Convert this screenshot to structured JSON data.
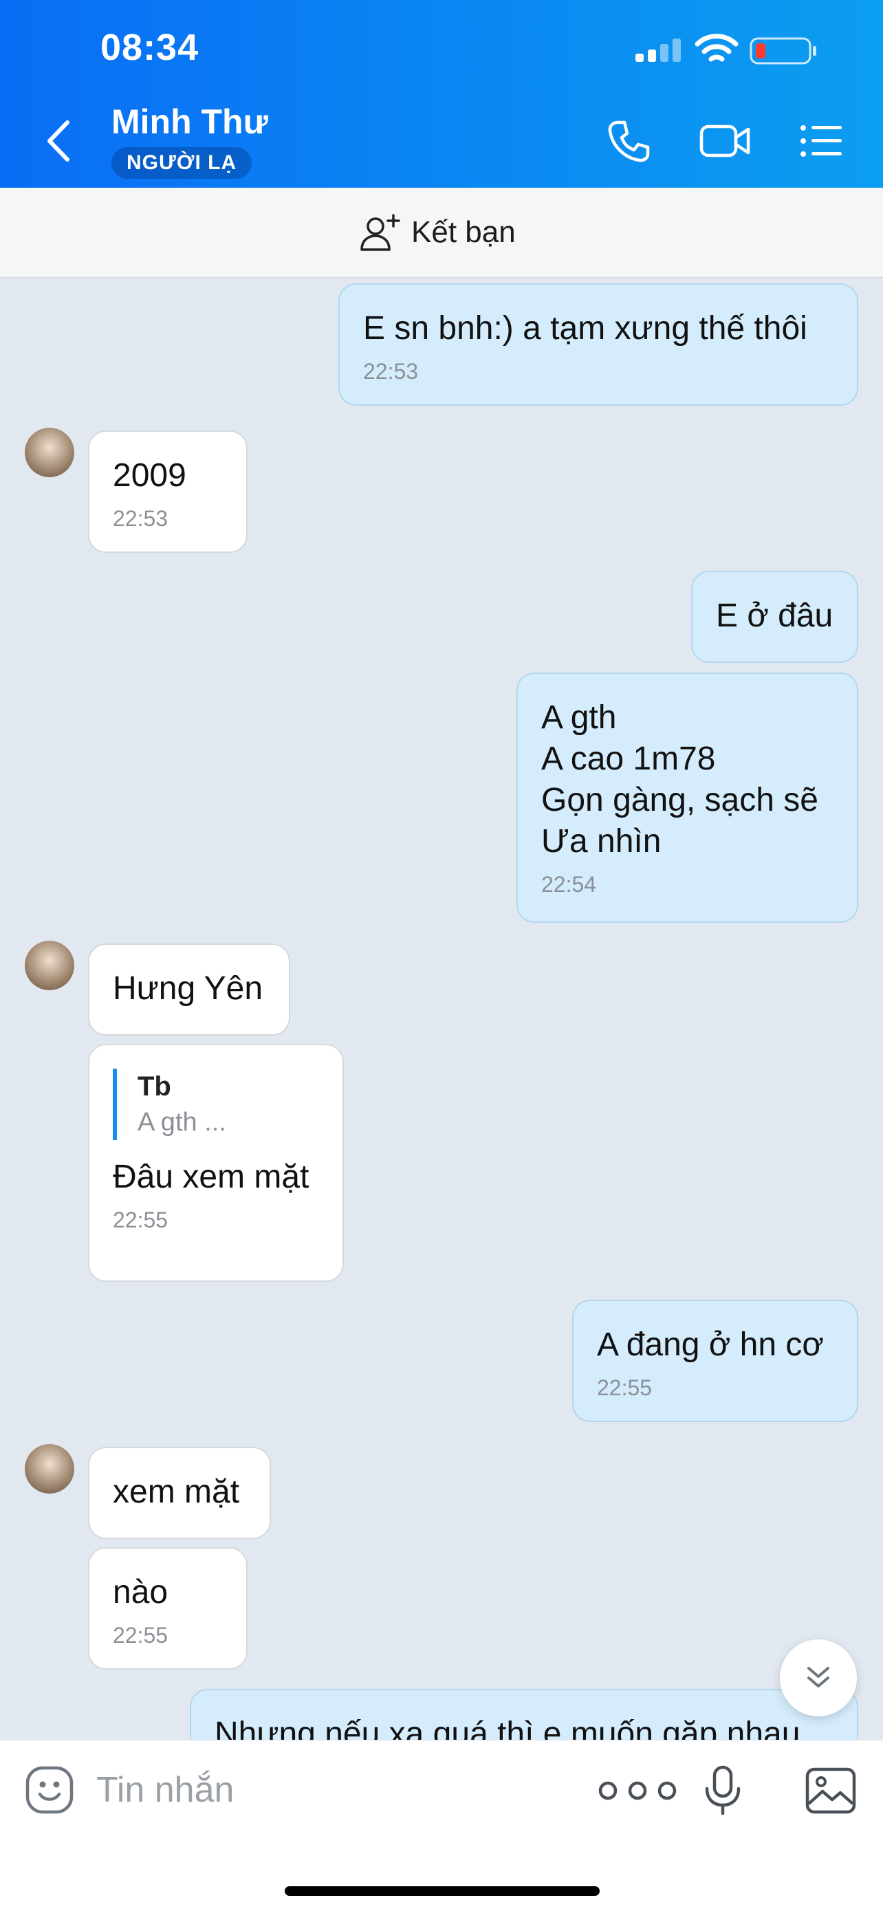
{
  "status_bar": {
    "time": "08:34"
  },
  "header": {
    "contact_name": "Minh Thư",
    "contact_badge": "NGƯỜI LẠ"
  },
  "add_friend": {
    "label": "Kết bạn"
  },
  "messages": [
    {
      "sender": "me",
      "lines": [
        "E sn bnh:) a tạm xưng thế thôi"
      ],
      "time": "22:53"
    },
    {
      "sender": "them",
      "lines": [
        "2009"
      ],
      "time": "22:53"
    },
    {
      "sender": "me",
      "lines": [
        "E ở đâu"
      ],
      "time": ""
    },
    {
      "sender": "me",
      "lines": [
        "A gth",
        "A cao 1m78",
        "Gọn gàng, sạch sẽ",
        "Ưa nhìn"
      ],
      "time": "22:54"
    },
    {
      "sender": "them",
      "lines": [
        "Hưng Yên"
      ],
      "time": ""
    },
    {
      "sender": "them",
      "quote": {
        "title": "Tb",
        "text": "A gth ..."
      },
      "lines": [
        "Đâu xem mặt"
      ],
      "time": "22:55"
    },
    {
      "sender": "me",
      "lines": [
        "A đang ở hn cơ"
      ],
      "time": "22:55"
    },
    {
      "sender": "them",
      "lines": [
        "xem mặt"
      ],
      "time": ""
    },
    {
      "sender": "them",
      "lines": [
        "nào"
      ],
      "time": "22:55"
    },
    {
      "sender": "me",
      "lines": [
        "Nhưng nếu xa quá thì e muốn gặp nhau"
      ],
      "time": ""
    }
  ],
  "composer": {
    "placeholder": "Tin nhắn"
  },
  "icons": {
    "back": "chevron-left-icon",
    "call": "phone-icon",
    "video": "video-camera-icon",
    "menu": "list-icon",
    "add_friend": "add-person-icon",
    "emoji": "sticker-icon",
    "more": "more-dots-icon",
    "mic": "microphone-icon",
    "image": "image-icon",
    "scroll_down": "double-chevron-down-icon"
  },
  "colors": {
    "header_start": "#0a6df5",
    "header_end": "#0b9ef0",
    "my_bubble": "#d4ecfb",
    "their_bubble": "#ffffff",
    "chat_bg": "#e2e8f0"
  }
}
